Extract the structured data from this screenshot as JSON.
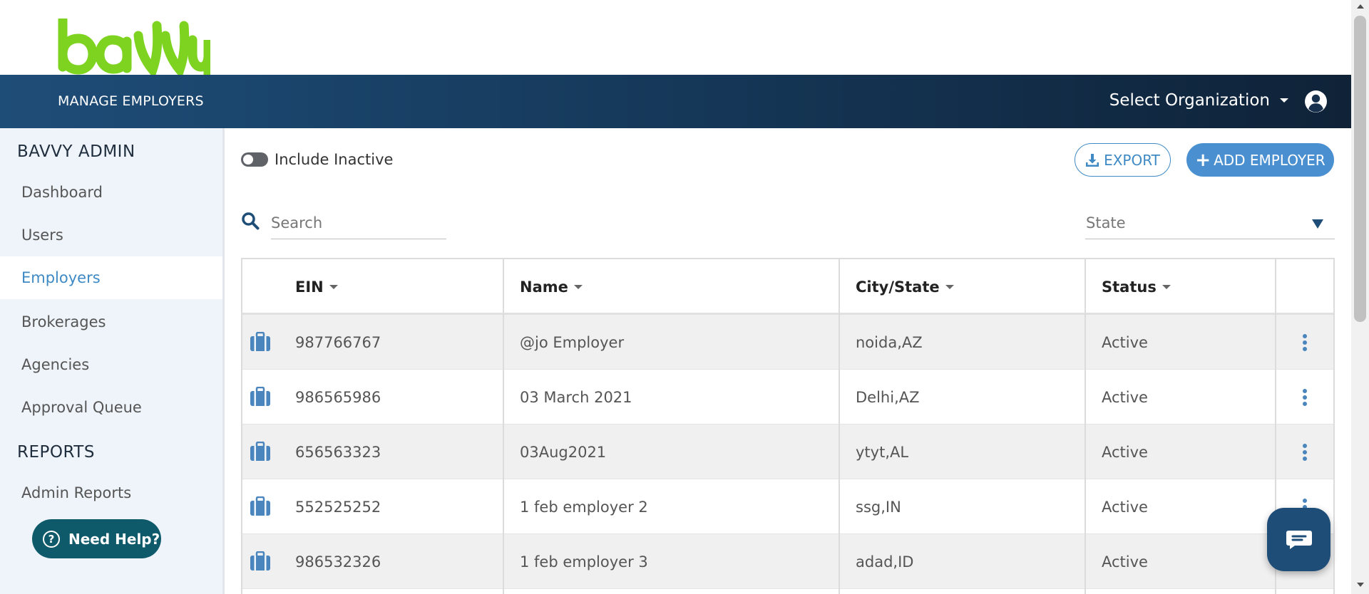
{
  "brand": {
    "logo_text": "bavvy",
    "logo_color": "#7ed321"
  },
  "banner": {
    "title": "MANAGE EMPLOYERS",
    "org_select": "Select Organization",
    "user_icon": "user-circle-icon"
  },
  "sidebar": {
    "sections": [
      {
        "heading": "BAVVY ADMIN",
        "items": [
          "Dashboard",
          "Users",
          "Employers",
          "Brokerages",
          "Agencies",
          "Approval Queue"
        ]
      },
      {
        "heading": "REPORTS",
        "items": [
          "Admin Reports"
        ]
      }
    ],
    "active_item": "Employers",
    "help_label": "Need Help?"
  },
  "toolbar": {
    "include_inactive_label": "Include Inactive",
    "include_inactive_on": false,
    "export_label": "EXPORT",
    "add_label": "ADD EMPLOYER"
  },
  "filters": {
    "search_placeholder": "Search",
    "state_placeholder": "State"
  },
  "table": {
    "columns": [
      "EIN",
      "Name",
      "City/State",
      "Status"
    ],
    "rows": [
      {
        "ein": "987766767",
        "name": "@jo Employer",
        "city_state": "noida,AZ",
        "status": "Active"
      },
      {
        "ein": "986565986",
        "name": "03 March 2021",
        "city_state": "Delhi,AZ",
        "status": "Active"
      },
      {
        "ein": "656563323",
        "name": "03Aug2021",
        "city_state": "ytyt,AL",
        "status": "Active"
      },
      {
        "ein": "552525252",
        "name": "1 feb employer 2",
        "city_state": "ssg,IN",
        "status": "Active"
      },
      {
        "ein": "986532326",
        "name": "1 feb employer 3",
        "city_state": "adad,ID",
        "status": "Active"
      }
    ]
  },
  "colors": {
    "accent": "#3f8ac4",
    "banner_dark": "#0f2238",
    "banner_light": "#1e4d78",
    "help": "#0f5a6a"
  }
}
